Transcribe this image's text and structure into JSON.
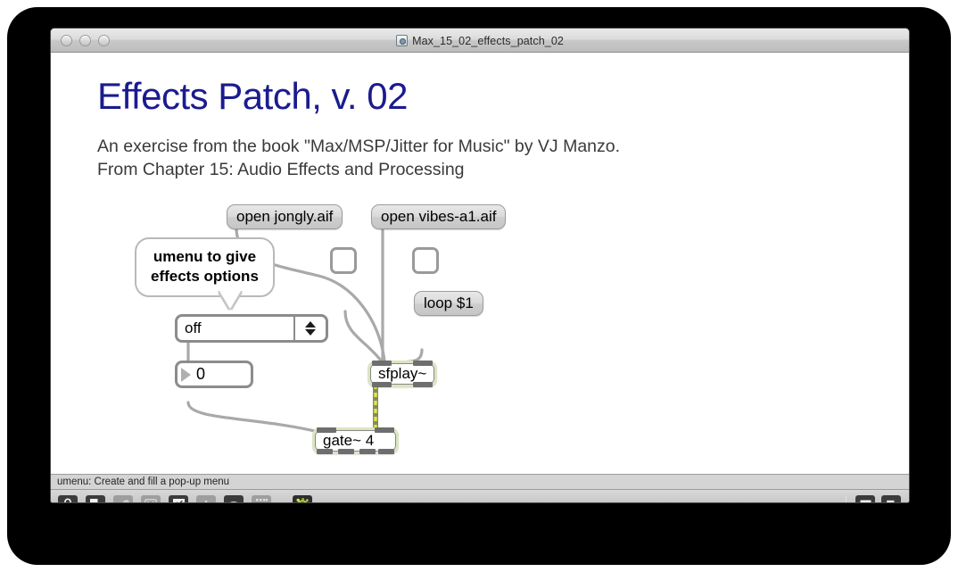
{
  "window": {
    "title": "Max_15_02_effects_patch_02",
    "doc_icon": "max-document-icon",
    "controls": [
      "close-button",
      "minimize-button",
      "zoom-button"
    ]
  },
  "canvas": {
    "page_title": "Effects Patch, v. 02",
    "subtitle_line_1": "An exercise from the book \"Max/MSP/Jitter for Music\" by VJ Manzo.",
    "subtitle_line_2": "From Chapter 15: Audio Effects and Processing",
    "objects": {
      "msg_open_jongly": "open jongly.aif",
      "msg_open_vibes": "open vibes-a1.aif",
      "msg_loop": "loop $1",
      "comment_balloon_line_1": "umenu to give",
      "comment_balloon_line_2": "effects options",
      "umenu_value": "off",
      "number_box_value": "0",
      "obj_sfplay": "sfplay~",
      "obj_gate": "gate~ 4",
      "toggle_left": "",
      "toggle_right": ""
    }
  },
  "statusbar": {
    "text": "umenu: Create and fill a pop-up menu"
  },
  "toolbar": {
    "buttons": [
      {
        "name": "lock-icon",
        "glyph": "ὑ2"
      },
      {
        "name": "presentation-mode-icon",
        "glyph": ""
      },
      {
        "name": "patch-cords-icon",
        "glyph": ""
      },
      {
        "name": "delete-icon",
        "glyph": "×"
      },
      {
        "name": "inspector-icon",
        "glyph": ""
      },
      {
        "name": "info-icon",
        "glyph": "i"
      },
      {
        "name": "object-explorer-icon",
        "glyph": ""
      },
      {
        "name": "grid-icon",
        "glyph": ""
      },
      {
        "name": "audio-settings-icon",
        "glyph": ""
      }
    ],
    "right_buttons": [
      {
        "name": "show-sidebar-bottom-icon"
      },
      {
        "name": "show-sidebar-right-icon"
      }
    ]
  },
  "colors": {
    "title_blue": "#1b1b8f",
    "signal_green": "#dbe5c2",
    "signal_cord": "#cfe04a",
    "cord_grey": "#a8a8a8",
    "window_chrome": "#c8c8c8",
    "audio_icon_green": "#9ec93a"
  }
}
